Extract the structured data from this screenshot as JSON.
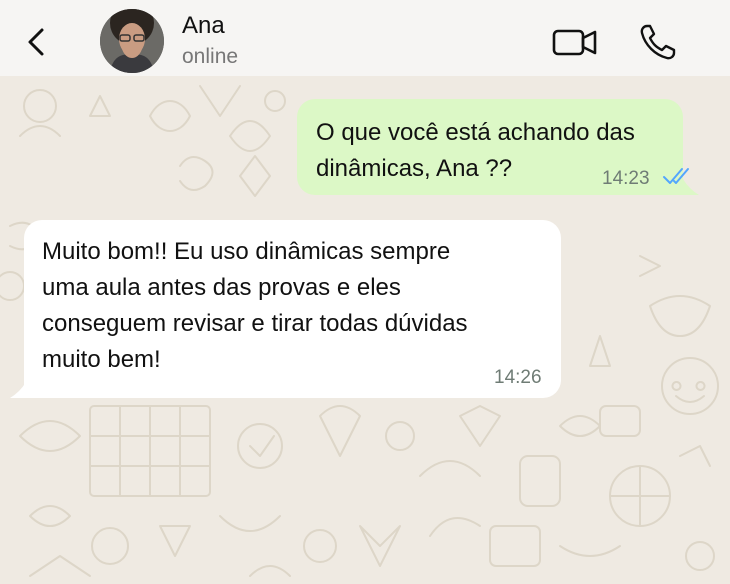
{
  "header": {
    "contact_name": "Ana",
    "contact_status": "online",
    "icons": {
      "back": "chevron-left-icon",
      "video": "video-camera-icon",
      "call": "phone-icon"
    }
  },
  "messages": [
    {
      "direction": "outgoing",
      "lines": [
        "O que você está achando das",
        "dinâmicas, Ana ??"
      ],
      "time": "14:23",
      "read_receipt": "double-check-read"
    },
    {
      "direction": "incoming",
      "lines": [
        "Muito bom!! Eu uso dinâmicas sempre",
        "uma aula antes das provas e eles",
        "conseguem revisar e tirar todas dúvidas",
        "muito bem!"
      ],
      "time": "14:26"
    }
  ],
  "colors": {
    "header_bg": "#f6f5f3",
    "chat_bg": "#efeae2",
    "outgoing_bubble": "#dcf8c6",
    "incoming_bubble": "#ffffff",
    "read_tick": "#53a6fd"
  }
}
